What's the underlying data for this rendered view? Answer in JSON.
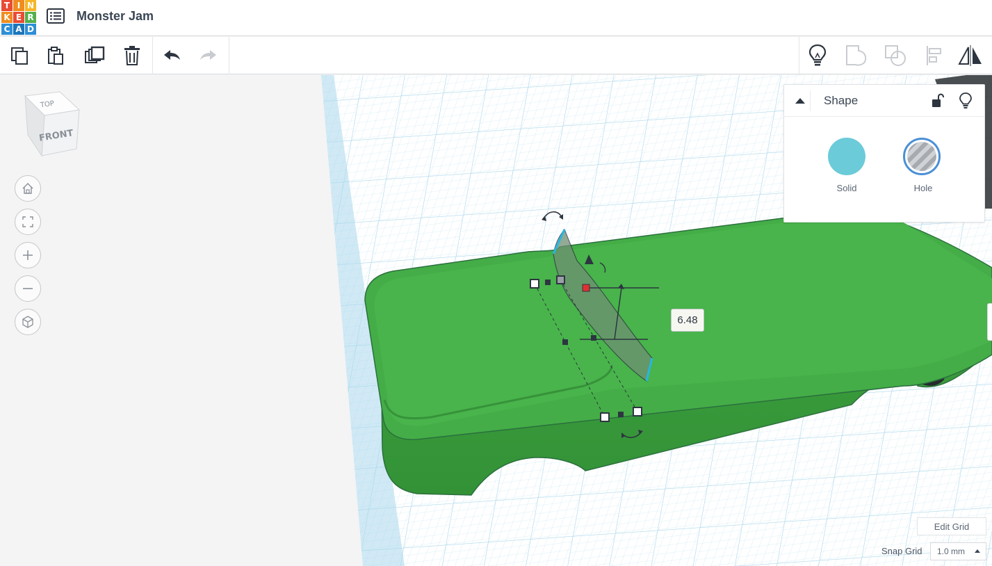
{
  "app": {
    "logo_letters": [
      "T",
      "I",
      "N",
      "K",
      "E",
      "R",
      "C",
      "A",
      "D"
    ],
    "logo_colors": [
      "#e94b35",
      "#f08c1f",
      "#f6b626",
      "#f08c1f",
      "#e94b35",
      "#52b04a",
      "#2d8fd5",
      "#1b75bb",
      "#2d8fd5"
    ],
    "design_title": "Monster Jam",
    "design_list_icon": "list-icon"
  },
  "toolbar": {
    "left": [
      {
        "name": "copy-icon"
      },
      {
        "name": "paste-icon"
      },
      {
        "name": "duplicate-icon"
      },
      {
        "name": "delete-icon"
      },
      {
        "name": "undo-icon"
      },
      {
        "name": "redo-icon"
      }
    ],
    "right": [
      {
        "name": "lightbulb-icon"
      },
      {
        "name": "group-icon"
      },
      {
        "name": "ungroup-icon"
      },
      {
        "name": "align-icon"
      },
      {
        "name": "mirror-icon"
      }
    ]
  },
  "viewcube": {
    "top_label": "TOP",
    "front_label": "FRONT"
  },
  "nav_buttons": [
    "home-icon",
    "fit-view-icon",
    "zoom-in-icon",
    "zoom-out-icon",
    "perspective-icon"
  ],
  "shape_panel": {
    "title": "Shape",
    "solid_label": "Solid",
    "hole_label": "Hole",
    "solid_color": "#6ccbd9",
    "selected": "Hole"
  },
  "dimension_value": "6.48",
  "grid": {
    "edit_label": "Edit Grid",
    "snap_label": "Snap Grid",
    "snap_value": "1.0 mm"
  },
  "colors": {
    "workplane_grid": "#bfe3f1",
    "workplane_bg": "#ffffff",
    "body_green": "#44ad47",
    "body_dark_green": "#2f8f34",
    "hole_gray": "#7c9c7e"
  }
}
